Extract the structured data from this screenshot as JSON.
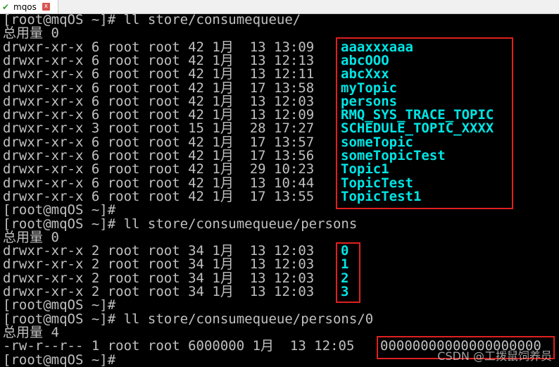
{
  "window": {
    "tab_title": "mqos",
    "tab_status_icon": "check-icon",
    "tab_close_icon": "close-icon"
  },
  "terminal": {
    "lines": [
      {
        "left": "[root@mqOS ~]# ll store/consumequeue/",
        "right": ""
      },
      {
        "left": "总用量 0",
        "right": ""
      },
      {
        "left": "drwxr-xr-x 6 root root 42 1月  13 13:09 ",
        "right": "aaaxxxaaa"
      },
      {
        "left": "drwxr-xr-x 6 root root 42 1月  13 12:13 ",
        "right": "abcOOO"
      },
      {
        "left": "drwxr-xr-x 6 root root 42 1月  13 12:11 ",
        "right": "abcXxx"
      },
      {
        "left": "drwxr-xr-x 6 root root 42 1月  17 13:58 ",
        "right": "myTopic"
      },
      {
        "left": "drwxr-xr-x 6 root root 42 1月  13 12:03 ",
        "right": "persons"
      },
      {
        "left": "drwxr-xr-x 6 root root 42 1月  13 12:09 ",
        "right": "RMQ_SYS_TRACE_TOPIC"
      },
      {
        "left": "drwxr-xr-x 3 root root 15 1月  28 17:27 ",
        "right": "SCHEDULE_TOPIC_XXXX"
      },
      {
        "left": "drwxr-xr-x 6 root root 42 1月  17 13:57 ",
        "right": "someTopic"
      },
      {
        "left": "drwxr-xr-x 6 root root 42 1月  17 13:56 ",
        "right": "someTopicTest"
      },
      {
        "left": "drwxr-xr-x 6 root root 42 1月  29 10:23 ",
        "right": "Topic1"
      },
      {
        "left": "drwxr-xr-x 6 root root 42 1月  13 10:44 ",
        "right": "TopicTest"
      },
      {
        "left": "drwxr-xr-x 6 root root 42 1月  17 13:55 ",
        "right": "TopicTest1"
      },
      {
        "left": "[root@mqOS ~]#",
        "right": ""
      },
      {
        "left": "[root@mqOS ~]# ll store/consumequeue/persons",
        "right": ""
      },
      {
        "left": "总用量 0",
        "right": ""
      },
      {
        "left": "drwxr-xr-x 2 root root 34 1月  13 12:03 ",
        "right": "0"
      },
      {
        "left": "drwxr-xr-x 2 root root 34 1月  13 12:03 ",
        "right": "1"
      },
      {
        "left": "drwxr-xr-x 2 root root 34 1月  13 12:03 ",
        "right": "2"
      },
      {
        "left": "drwxr-xr-x 2 root root 34 1月  13 12:03 ",
        "right": "3"
      },
      {
        "left": "[root@mqOS ~]#",
        "right": ""
      },
      {
        "left": "[root@mqOS ~]# ll store/consumequeue/persons/0",
        "right": ""
      },
      {
        "left": "总用量 4",
        "right": ""
      },
      {
        "left": "-rw-r--r-- 1 root root 6000000 1月  13 12:05 ",
        "right": "00000000000000000000"
      },
      {
        "left": "[root@mqOS ~]# ",
        "right": ""
      }
    ]
  },
  "watermark": "CSDN @工拨鼠饲养员"
}
